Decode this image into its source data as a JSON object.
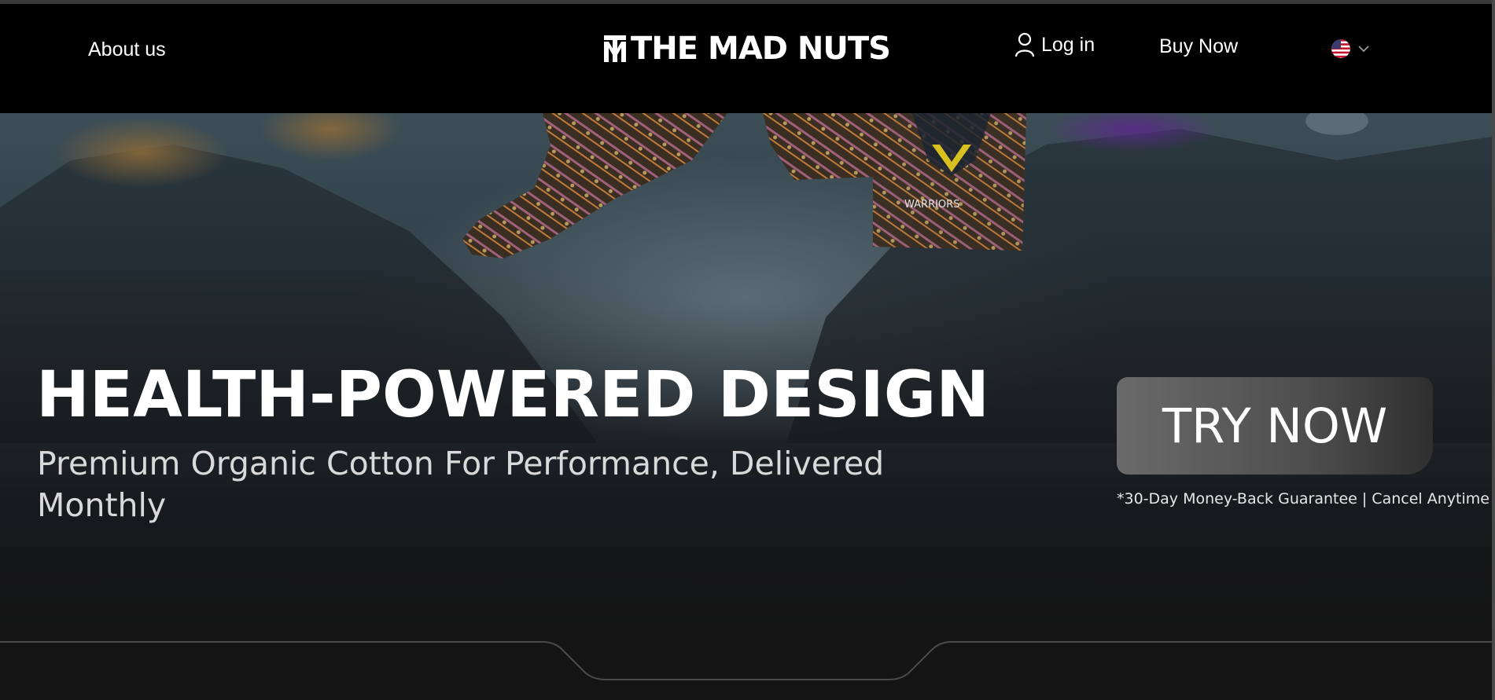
{
  "header": {
    "about_label": "About us",
    "logo_text": "THE MAD NUTS",
    "login_label": "Log in",
    "buy_label": "Buy Now",
    "language_icon": "us-flag-icon"
  },
  "hero": {
    "title": "HEALTH-POWERED DESIGN",
    "subtitle": "Premium Organic Cotton For Performance, Delivered Monthly",
    "cta_label": "TRY NOW",
    "guarantee": "*30-Day Money-Back Guarantee | Cancel Anytime",
    "box_label": "WARRIORS"
  },
  "colors": {
    "header_bg": "#000000",
    "page_bg": "#141414",
    "cta_bg": "#5a5a5a",
    "text": "#ffffff"
  }
}
